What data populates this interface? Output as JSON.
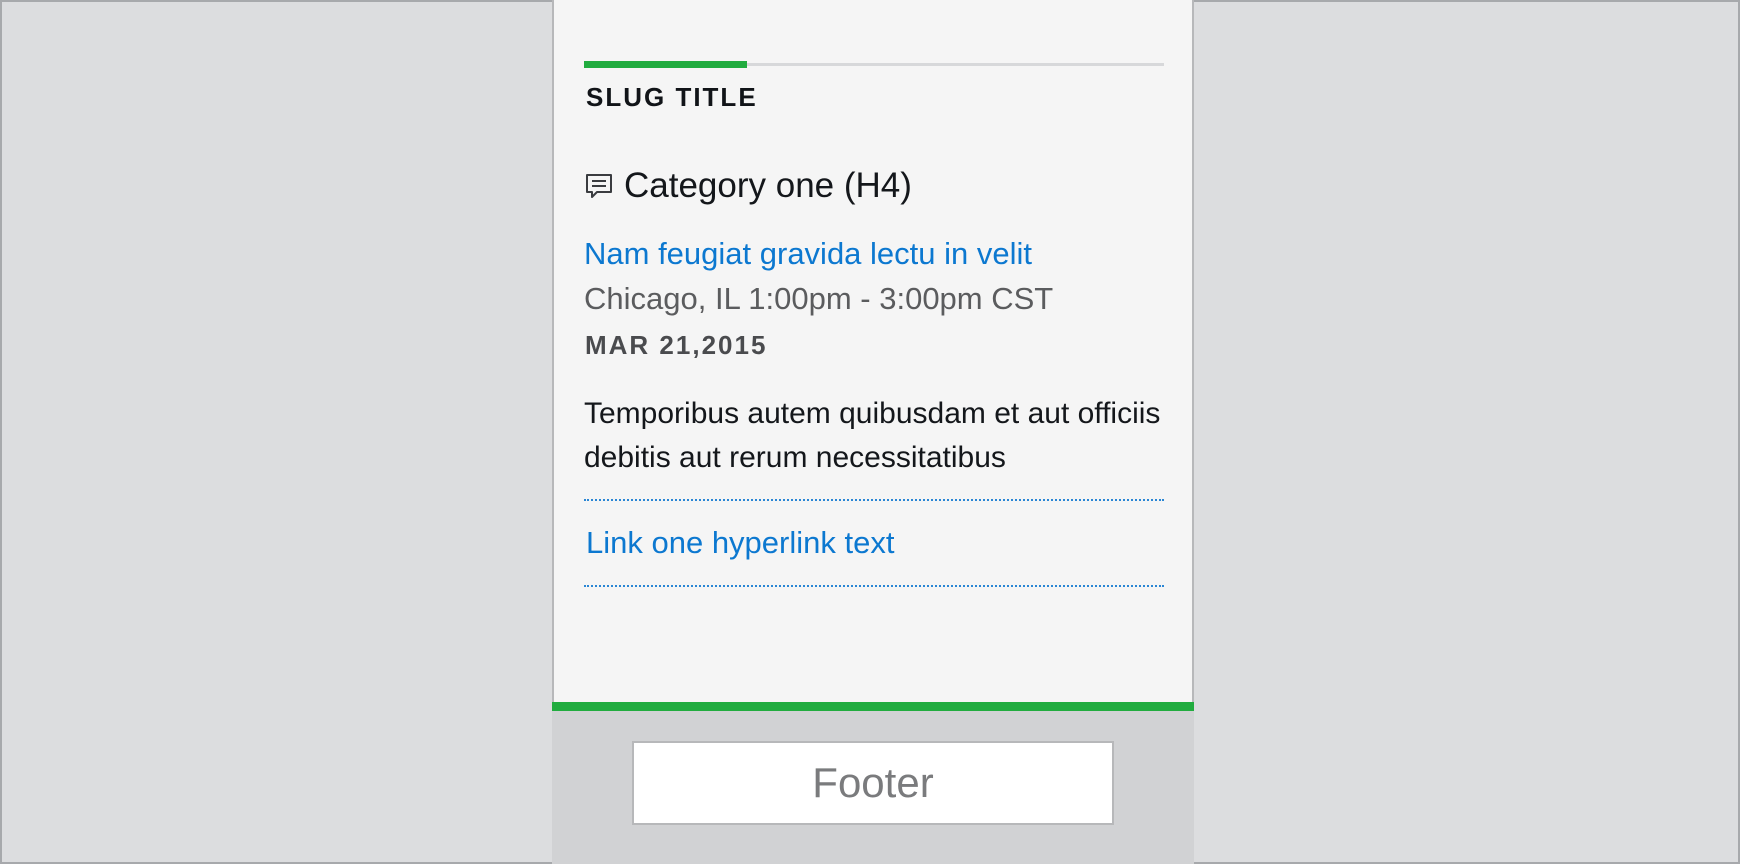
{
  "module": {
    "slug_title": "SLUG TITLE",
    "category_icon": "comment-icon",
    "category_title": "Category one (H4)",
    "event": {
      "title_link": "Nam feugiat gravida lectu in velit",
      "location_time": "Chicago, IL 1:00pm - 3:00pm CST",
      "date": "MAR 21,2015"
    },
    "body": "Temporibus autem quibusdam et aut officiis debitis aut rerum necessitatibus",
    "link_one": "Link one hyperlink text"
  },
  "footer": {
    "label": "Footer"
  },
  "colors": {
    "accent_green": "#21ac3f",
    "link_blue": "#0c78d0",
    "card_bg": "#f5f5f5",
    "page_bg": "#dcdddf"
  }
}
